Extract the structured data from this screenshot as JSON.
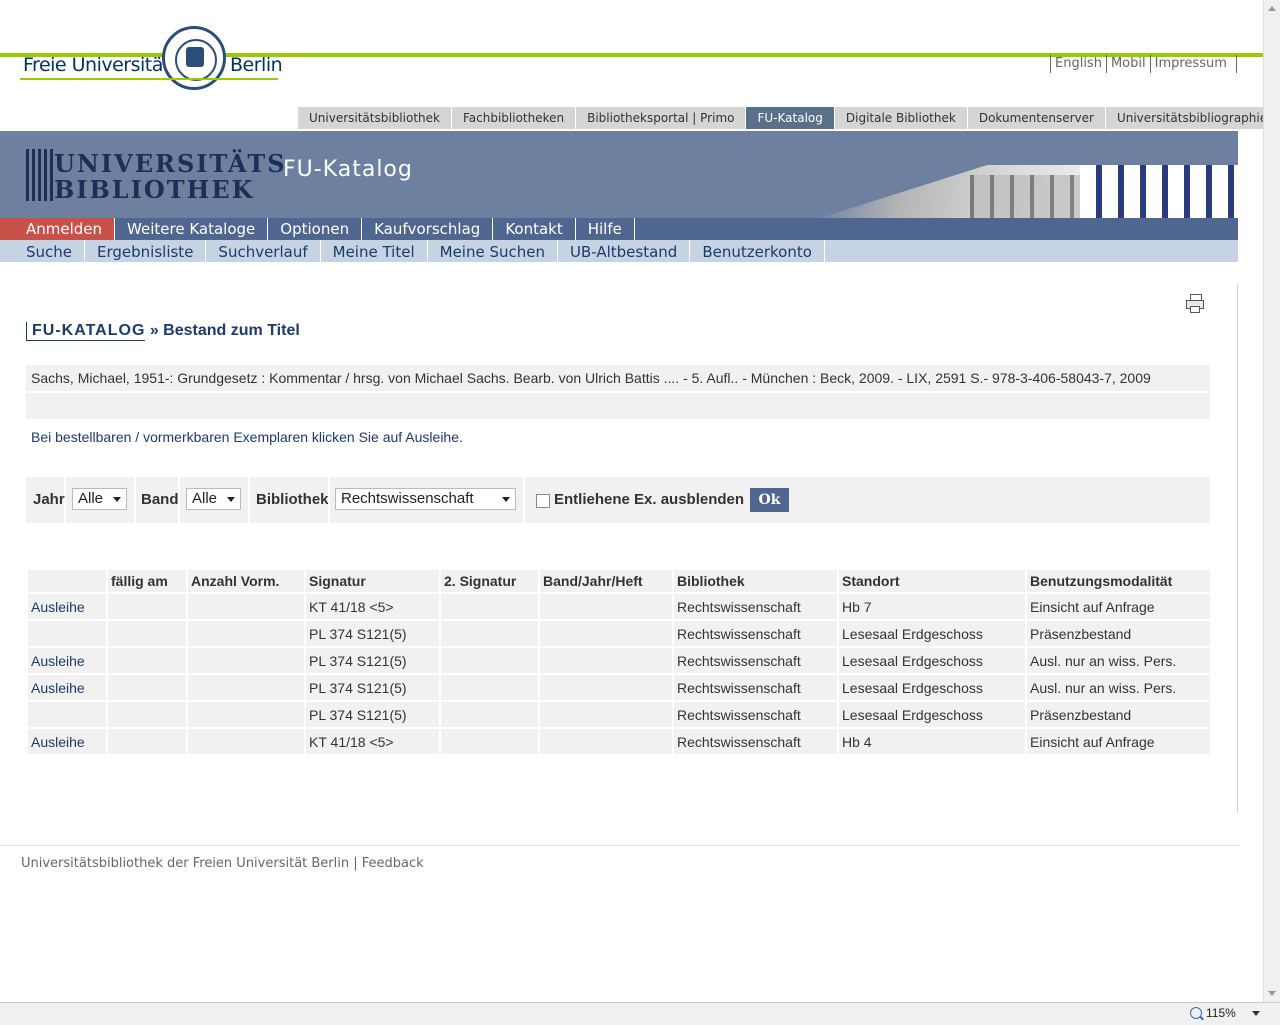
{
  "header": {
    "logo_left": "Freie Universität",
    "logo_right": "Berlin",
    "top_links": [
      "English",
      "Mobil",
      "Impressum"
    ]
  },
  "portal_nav": [
    "Universitätsbibliothek",
    "Fachbibliotheken",
    "Bibliotheksportal | Primo",
    "FU-Katalog",
    "Digitale Bibliothek",
    "Dokumentenserver",
    "Universitätsbibliographie"
  ],
  "portal_nav_active": "FU-Katalog",
  "banner": {
    "ub_line1": "Universitäts",
    "ub_line2": "Bibliothek",
    "title": "FU-Katalog"
  },
  "main_nav": [
    "Anmelden",
    "Weitere Kataloge",
    "Optionen",
    "Kaufvorschlag",
    "Kontakt",
    "Hilfe"
  ],
  "sub_nav": [
    "Suche",
    "Ergebnisliste",
    "Suchverlauf",
    "Meine Titel",
    "Meine Suchen",
    "UB-Altbestand",
    "Benutzerkonto"
  ],
  "page": {
    "crumb": "FU-KATALOG",
    "title_suffix": " » Bestand zum Titel",
    "record": "Sachs, Michael, 1951-: Grundgesetz : Kommentar / hrsg. von Michael Sachs. Bearb. von Ulrich Battis .... - 5. Aufl.. - München : Beck, 2009. - LIX, 2591 S.- 978-3-406-58043-7, 2009",
    "info": "Bei bestellbaren / vormerkbaren Exemplaren klicken Sie auf Ausleihe."
  },
  "filters": {
    "year_label": "Jahr",
    "year_value": "Alle",
    "band_label": "Band",
    "band_value": "Alle",
    "library_label": "Bibliothek",
    "library_value": "Rechtswissenschaft",
    "hide_label": "Entliehene Ex. ausblenden",
    "ok_label": "Ok"
  },
  "table": {
    "headers": [
      "",
      "fällig am",
      "Anzahl Vorm.",
      "Signatur",
      "2. Signatur",
      "Band/Jahr/Heft",
      "Bibliothek",
      "Standort",
      "Benutzungsmodalität"
    ],
    "rows": [
      [
        "Ausleihe",
        "",
        "",
        "KT 41/18 <5>",
        "",
        "",
        "Rechtswissenschaft",
        "Hb 7",
        "Einsicht auf Anfrage"
      ],
      [
        "",
        "",
        "",
        "PL 374 S121(5)",
        "",
        "",
        "Rechtswissenschaft",
        "Lesesaal Erdgeschoss",
        "Präsenzbestand"
      ],
      [
        "Ausleihe",
        "",
        "",
        "PL 374 S121(5)",
        "",
        "",
        "Rechtswissenschaft",
        "Lesesaal Erdgeschoss",
        "Ausl. nur an wiss. Pers."
      ],
      [
        "Ausleihe",
        "",
        "",
        "PL 374 S121(5)",
        "",
        "",
        "Rechtswissenschaft",
        "Lesesaal Erdgeschoss",
        "Ausl. nur an wiss. Pers."
      ],
      [
        "",
        "",
        "",
        "PL 374 S121(5)",
        "",
        "",
        "Rechtswissenschaft",
        "Lesesaal Erdgeschoss",
        "Präsenzbestand"
      ],
      [
        "Ausleihe",
        "",
        "",
        "KT 41/18 <5>",
        "",
        "",
        "Rechtswissenschaft",
        "Hb 4",
        "Einsicht auf Anfrage"
      ]
    ]
  },
  "footer": {
    "org": "Universitätsbibliothek der Freien Universität Berlin",
    "sep": " | ",
    "feedback": "Feedback"
  },
  "status": {
    "zoom": "115%"
  }
}
